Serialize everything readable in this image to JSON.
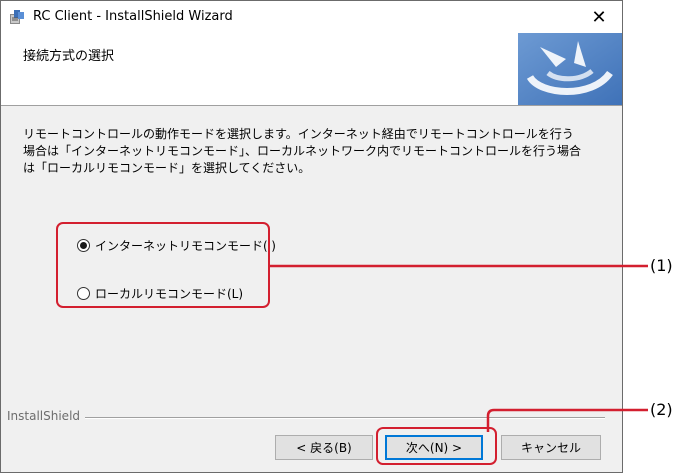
{
  "window": {
    "title": "RC Client - InstallShield Wizard",
    "close_glyph": "✕",
    "app_icon": "installer-icon"
  },
  "header": {
    "title": "接続方式の選択",
    "banner_icon": "installshield-swirl-logo"
  },
  "description": [
    "リモートコントロールの動作モードを選択します。インターネット経由でリモートコントロールを行う",
    "場合は「インターネットリモコンモード」、ローカルネットワーク内でリモートコントロールを行う場合",
    "は「ローカルリモコンモード」を選択してください。"
  ],
  "options": [
    {
      "label": "インターネットリモコンモード(I)",
      "selected": true
    },
    {
      "label": "ローカルリモコンモード(L)",
      "selected": false
    }
  ],
  "footer": {
    "brand": "InstallShield",
    "back_label": "< 戻る(B)",
    "next_label": "次へ(N) >",
    "cancel_label": "キャンセル"
  },
  "annotations": {
    "label_1": "(1)",
    "label_2": "(2)",
    "color": "#d31f2f"
  },
  "colors": {
    "banner_blue": "#4a7fc4",
    "focus_blue": "#0078d7"
  }
}
